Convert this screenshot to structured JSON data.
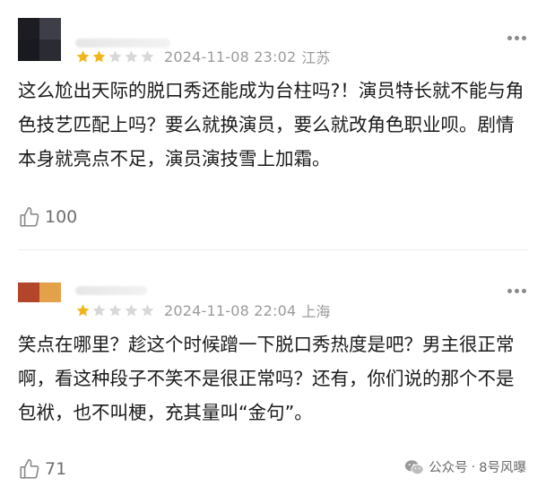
{
  "reviews": [
    {
      "avatar_colors": [
        "#1c1c22",
        "#3d3e47",
        "#191a1f",
        "#2b2c33"
      ],
      "rating": 2,
      "max_rating": 5,
      "datetime": "2024-11-08 23:02",
      "location": "江苏",
      "content": "这么尬出天际的脱口秀还能成为台柱吗?！演员特长就不能与角色技艺匹配上吗？要么就换演员，要么就改角色职业呗。剧情本身就亮点不足，演员演技雪上加霜。",
      "likes": "100"
    },
    {
      "avatar_colors": [
        "#b2452a",
        "#e3a24a"
      ],
      "rating": 1,
      "max_rating": 5,
      "datetime": "2024-11-08 22:04",
      "location": "上海",
      "content": "笑点在哪里？趁这个时候蹭一下脱口秀热度是吧？男主很正常啊，看这种段子不笑不是很正常吗？还有，你们说的那个不是包袱，也不叫梗，充其量叫“金句”。",
      "likes": "71"
    }
  ],
  "colors": {
    "star_on": "#f3b41a",
    "star_off": "#d8d8d8"
  },
  "watermark": {
    "icon": "wechat-icon",
    "label": "公众号",
    "separator": "·",
    "account": "8号风曝"
  }
}
